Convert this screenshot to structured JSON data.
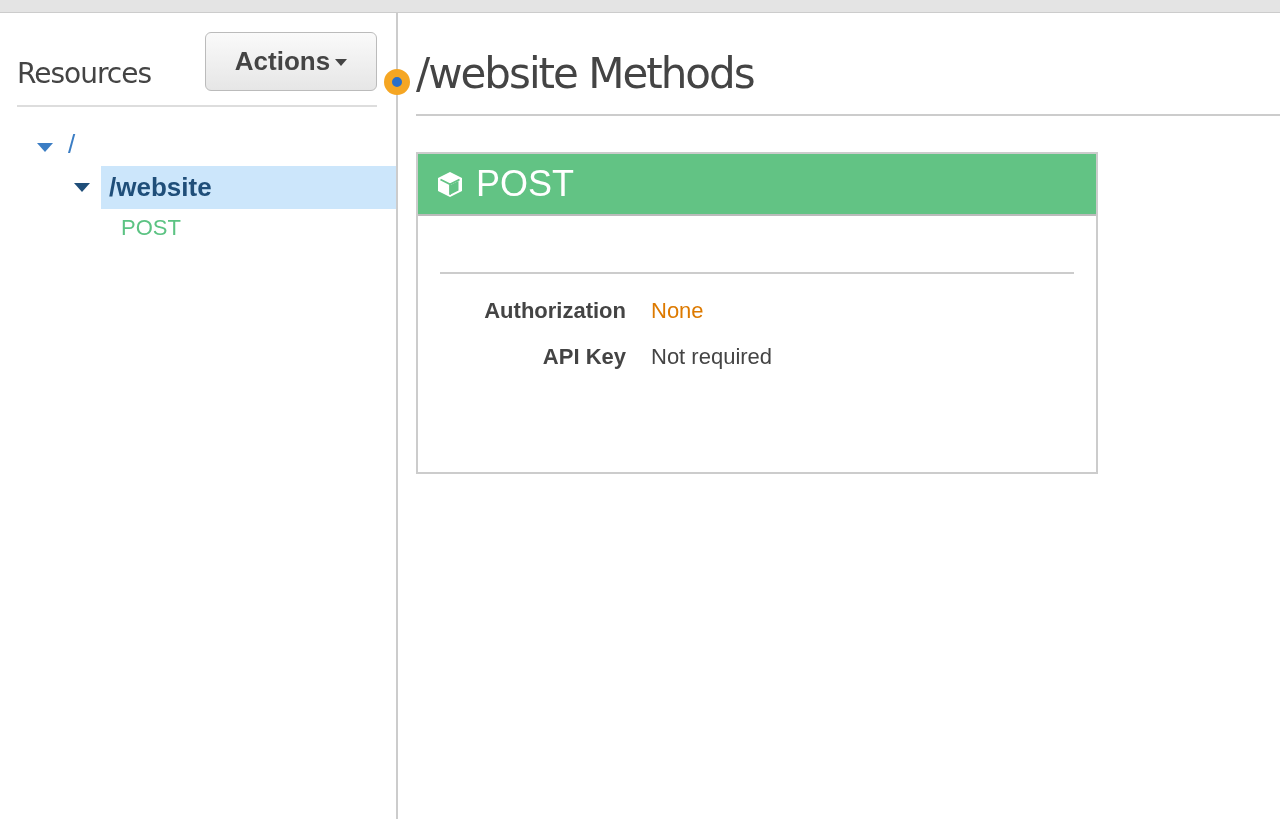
{
  "sidebar": {
    "title": "Resources",
    "actions_button": {
      "label": "Actions"
    },
    "tree": [
      {
        "kind": "resource",
        "label": "/",
        "expanded": true,
        "selected": false,
        "children": [
          {
            "kind": "resource",
            "label": "/website",
            "expanded": true,
            "selected": true,
            "children": [
              {
                "kind": "method",
                "label": "POST",
                "selected": false
              }
            ]
          }
        ]
      }
    ]
  },
  "main": {
    "title": "/website Methods",
    "method_card": {
      "method": "POST",
      "details": [
        {
          "label": "Authorization",
          "value": "None",
          "kind": "warning"
        },
        {
          "label": "API Key",
          "value": "Not required",
          "kind": "plain"
        }
      ]
    }
  }
}
